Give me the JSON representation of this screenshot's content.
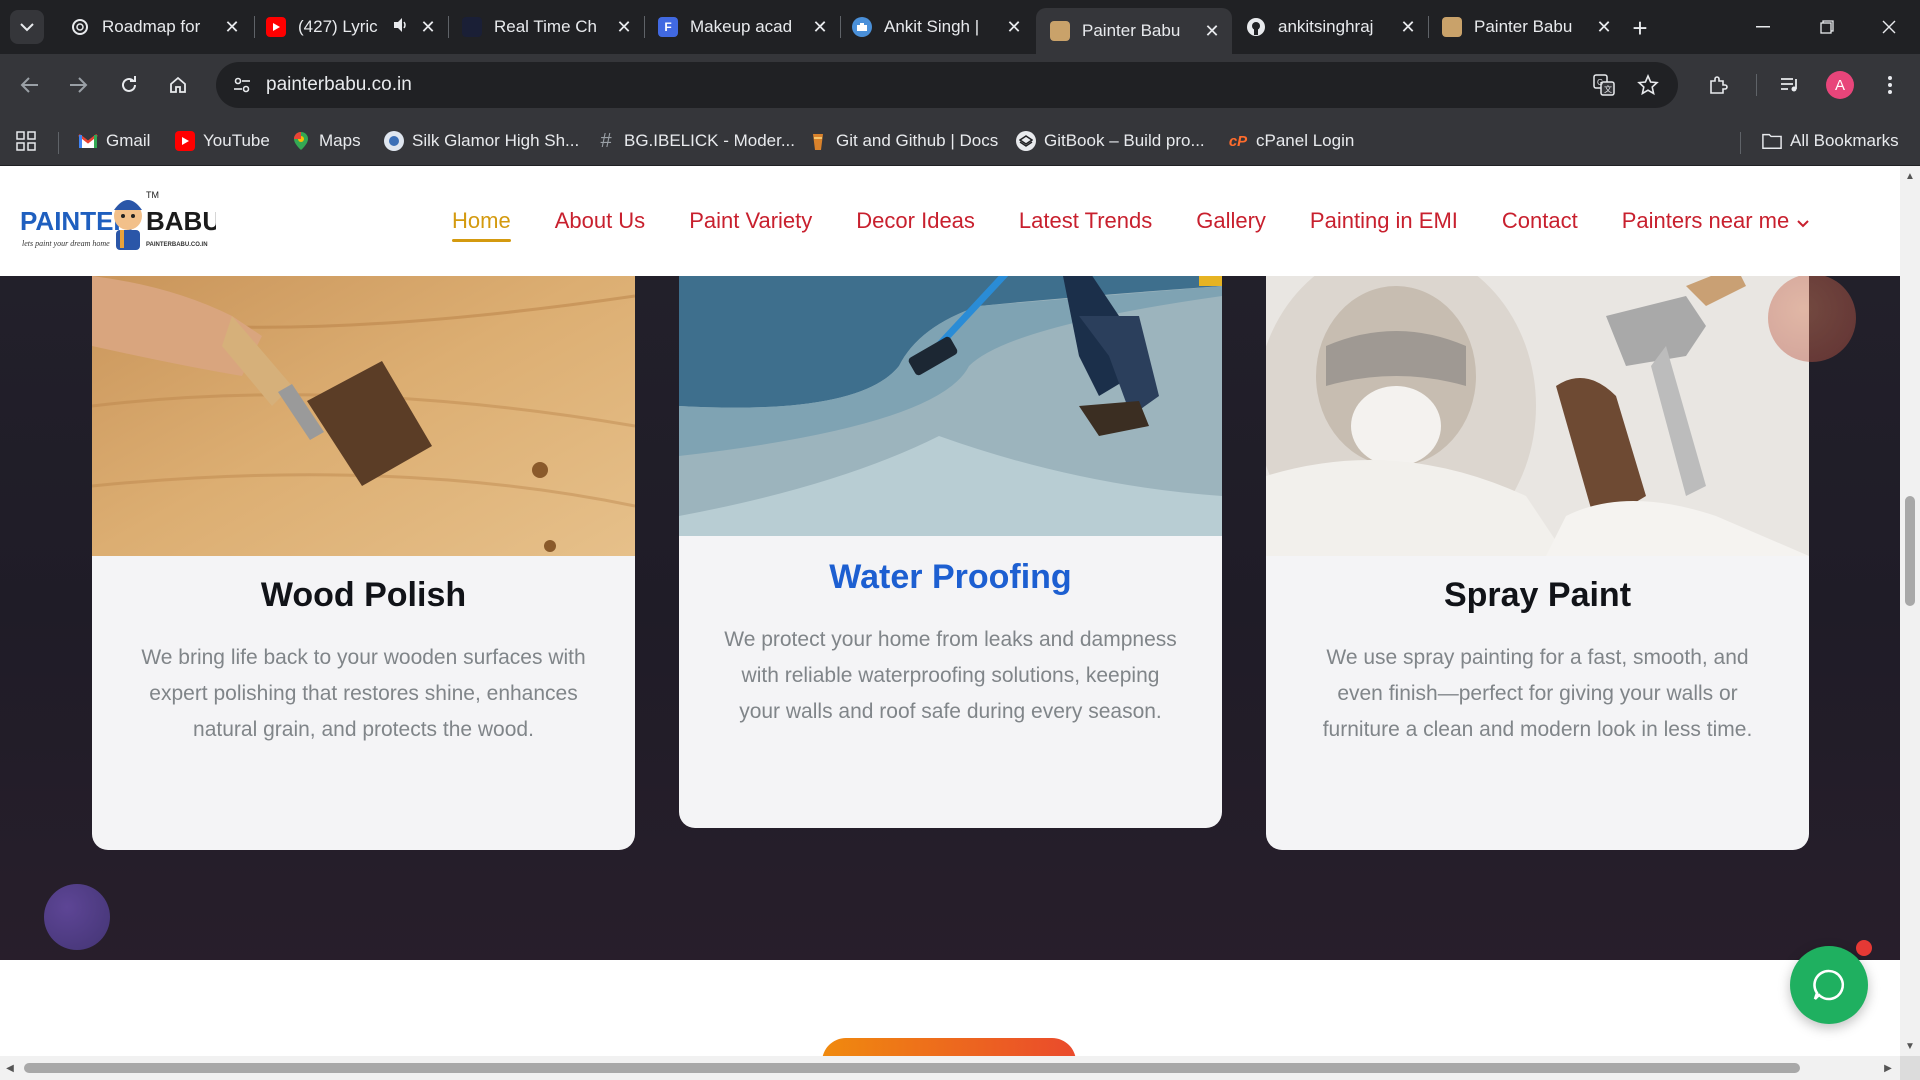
{
  "browser": {
    "tabs": [
      {
        "title": "Roadmap for",
        "icon": "openai-icon"
      },
      {
        "title": "(427) Lyric",
        "icon": "youtube-icon"
      },
      {
        "title": "Real Time Ch",
        "icon": "dark-site-icon"
      },
      {
        "title": "Makeup acad",
        "icon": "forms-icon"
      },
      {
        "title": "Ankit Singh |",
        "icon": "briefcase-icon"
      },
      {
        "title": "Painter Babu",
        "icon": "painter-babu-icon",
        "active": true
      },
      {
        "title": "ankitsinghraj",
        "icon": "github-icon"
      },
      {
        "title": "Painter Babu",
        "icon": "painter-babu-icon"
      }
    ],
    "url": "painterbabu.co.in",
    "profile_initial": "A",
    "bookmarks": [
      {
        "label": "Gmail",
        "icon": "gmail-icon"
      },
      {
        "label": "YouTube",
        "icon": "youtube-icon"
      },
      {
        "label": "Maps",
        "icon": "maps-icon"
      },
      {
        "label": "Silk Glamor High Sh...",
        "icon": "silk-icon"
      },
      {
        "label": "BG.IBELICK - Moder...",
        "icon": "hash-icon"
      },
      {
        "label": "Git and Github | Docs",
        "icon": "git-icon"
      },
      {
        "label": "GitBook – Build pro...",
        "icon": "gitbook-icon"
      },
      {
        "label": "cPanel Login",
        "icon": "cpanel-icon"
      }
    ],
    "all_bookmarks": "All Bookmarks"
  },
  "site": {
    "logo": {
      "text_left": "PAINTER",
      "text_right": "BABU",
      "tm": "TM",
      "tagline": "lets paint your dream home",
      "domain": "PAINTERBABU.CO.IN"
    },
    "nav": [
      {
        "label": "Home",
        "active": true
      },
      {
        "label": "About Us"
      },
      {
        "label": "Paint Variety"
      },
      {
        "label": "Decor Ideas"
      },
      {
        "label": "Latest Trends"
      },
      {
        "label": "Gallery"
      },
      {
        "label": "Painting in EMI"
      },
      {
        "label": "Contact"
      },
      {
        "label": "Painters near me",
        "dropdown": true
      }
    ],
    "cards": [
      {
        "title": "Wood Polish",
        "description": "We bring life back to your wooden surfaces with expert polishing that restores shine, enhances natural grain, and protects the wood."
      },
      {
        "title": "Water Proofing",
        "description": "We protect your home from leaks and dampness with reliable waterproofing solutions, keeping your walls and roof safe during every season.",
        "highlighted": true
      },
      {
        "title": "Spray Paint",
        "description": "We use spray painting for a fast, smooth, and even finish—perfect for giving your walls or furniture a clean and modern look in less time."
      }
    ]
  },
  "colors": {
    "nav_red": "#c8202e",
    "nav_active": "#d49a0f",
    "highlight_blue": "#1d5fd1",
    "whatsapp_green": "#1fb060"
  }
}
